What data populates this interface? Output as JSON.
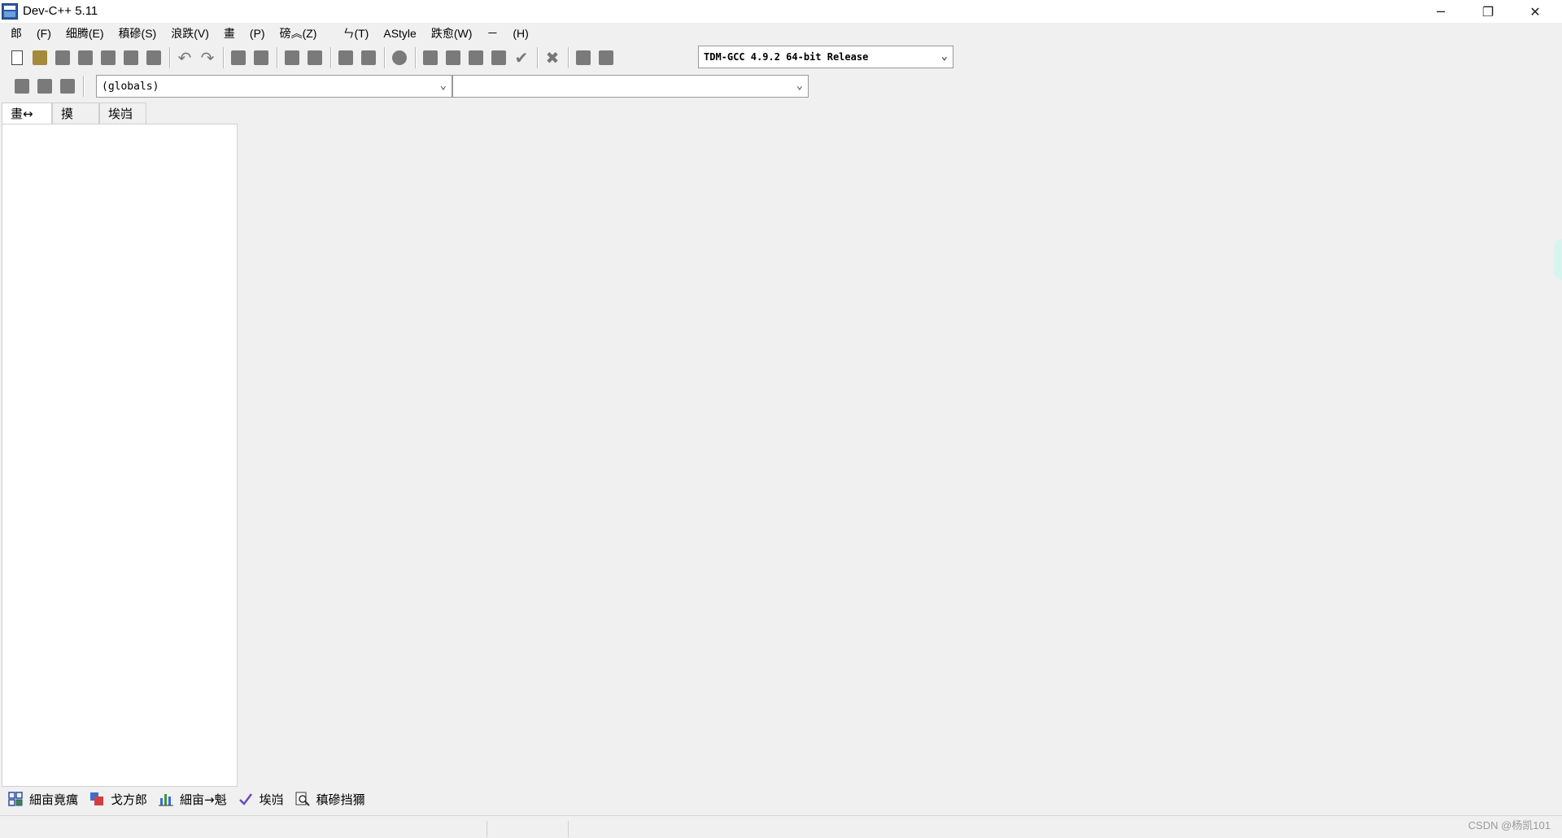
{
  "window": {
    "title": "Dev-C++ 5.11",
    "minimize": "─",
    "restore": "❐",
    "close": "✕"
  },
  "menu": [
    "郎",
    "(F)",
    "细腾(E)",
    "稹磣(S)",
    "浪跌(V)",
    "畫",
    "(P)",
    "磅︽(Z)",
    "ㄣ(T)",
    "AStyle",
    "跌愈(W)",
    "－",
    "(H)"
  ],
  "toolbar": {
    "compiler": "TDM-GCC 4.9.2 64-bit Release"
  },
  "scope": {
    "globals": "(globals)",
    "member": ""
  },
  "left_tabs": [
    "畫↔",
    "摸",
    "埃岿"
  ],
  "bottom_tabs": [
    {
      "label": "細亩竟癘",
      "icon": "grid-icon"
    },
    {
      "label": "戈方郎",
      "icon": "resources-icon"
    },
    {
      "label": "細亩→魁",
      "icon": "chart-icon"
    },
    {
      "label": "埃岿",
      "icon": "check-icon"
    },
    {
      "label": "稹磣挡獮",
      "icon": "search-icon"
    }
  ],
  "watermark": "CSDN @杨凯101"
}
